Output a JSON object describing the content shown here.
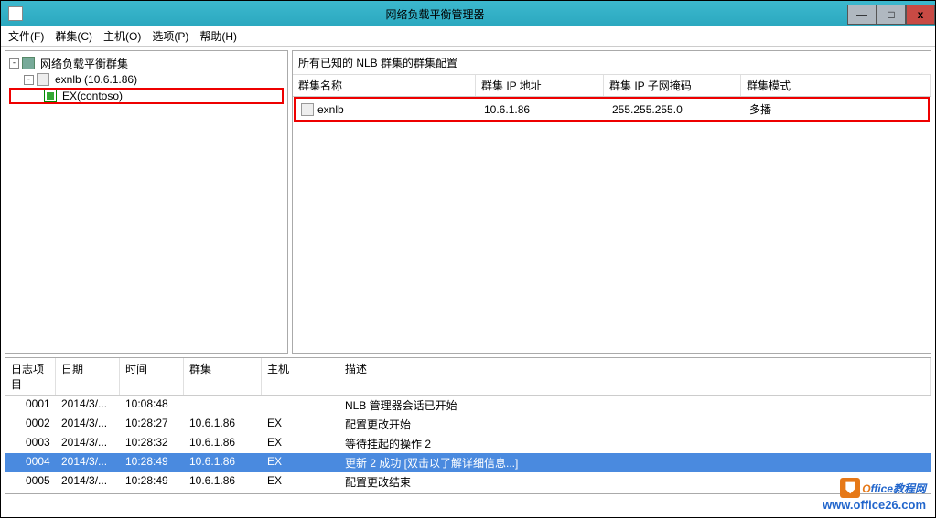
{
  "window": {
    "title": "网络负载平衡管理器",
    "min": "—",
    "max": "□",
    "close": "x"
  },
  "menu": {
    "file": "文件(F)",
    "cluster": "群集(C)",
    "host": "主机(O)",
    "options": "选项(P)",
    "help": "帮助(H)"
  },
  "tree": {
    "root": "网络负载平衡群集",
    "cluster": "exnlb (10.6.1.86)",
    "host": "EX(contoso)"
  },
  "detail": {
    "header": "所有已知的 NLB 群集的群集配置",
    "columns": {
      "name": "群集名称",
      "ip": "群集 IP 地址",
      "mask": "群集 IP 子网掩码",
      "mode": "群集模式"
    },
    "row": {
      "name": "exnlb",
      "ip": "10.6.1.86",
      "mask": "255.255.255.0",
      "mode": "多播"
    }
  },
  "log": {
    "columns": {
      "item": "日志项目",
      "date": "日期",
      "time": "时间",
      "cluster": "群集",
      "host": "主机",
      "desc": "描述"
    },
    "rows": [
      {
        "item": "0001",
        "date": "2014/3/...",
        "time": "10:08:48",
        "cluster": "",
        "host": "",
        "desc": "NLB 管理器会话已开始"
      },
      {
        "item": "0002",
        "date": "2014/3/...",
        "time": "10:28:27",
        "cluster": "10.6.1.86",
        "host": "EX",
        "desc": "配置更改开始"
      },
      {
        "item": "0003",
        "date": "2014/3/...",
        "time": "10:28:32",
        "cluster": "10.6.1.86",
        "host": "EX",
        "desc": "等待挂起的操作 2"
      },
      {
        "item": "0004",
        "date": "2014/3/...",
        "time": "10:28:49",
        "cluster": "10.6.1.86",
        "host": "EX",
        "desc": "更新 2 成功 [双击以了解详细信息...]"
      },
      {
        "item": "0005",
        "date": "2014/3/...",
        "time": "10:28:49",
        "cluster": "10.6.1.86",
        "host": "EX",
        "desc": "配置更改结束"
      }
    ],
    "selected": 3
  },
  "watermark": {
    "line1a": "O",
    "line1b": "ffice教程网",
    "line2": "www.office26.com"
  }
}
